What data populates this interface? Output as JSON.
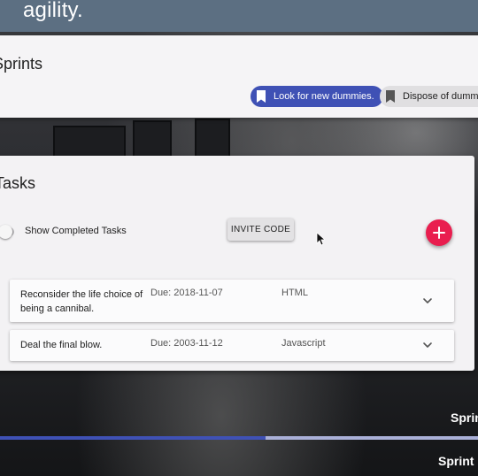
{
  "banner": {
    "title": "agility."
  },
  "sprints": {
    "title": "Sprints",
    "chips": [
      {
        "label": "Look for new dummies.",
        "icon": "bookmark-icon",
        "color": "#3f51b5"
      },
      {
        "label": "Dispose of dummies",
        "icon": "bookmark-icon",
        "color": "#e0dfe1"
      }
    ]
  },
  "tasks": {
    "title": "Tasks",
    "toggle_label": "Show Completed Tasks",
    "toggle_on": false,
    "invite_label": "INVITE CODE",
    "add_icon": "plus-icon",
    "add_color": "#e91e4f",
    "items": [
      {
        "name": "Reconsider the life choice of being a cannibal.",
        "due": "Due: 2018-11-07",
        "language": "HTML"
      },
      {
        "name": "Deal the final blow.",
        "due": "Due: 2003-11-12",
        "language": "Javascript"
      }
    ]
  },
  "sprint_list": [
    {
      "label": "Sprin"
    },
    {
      "label": "Sprint"
    }
  ],
  "sprint_progress": 0.555
}
